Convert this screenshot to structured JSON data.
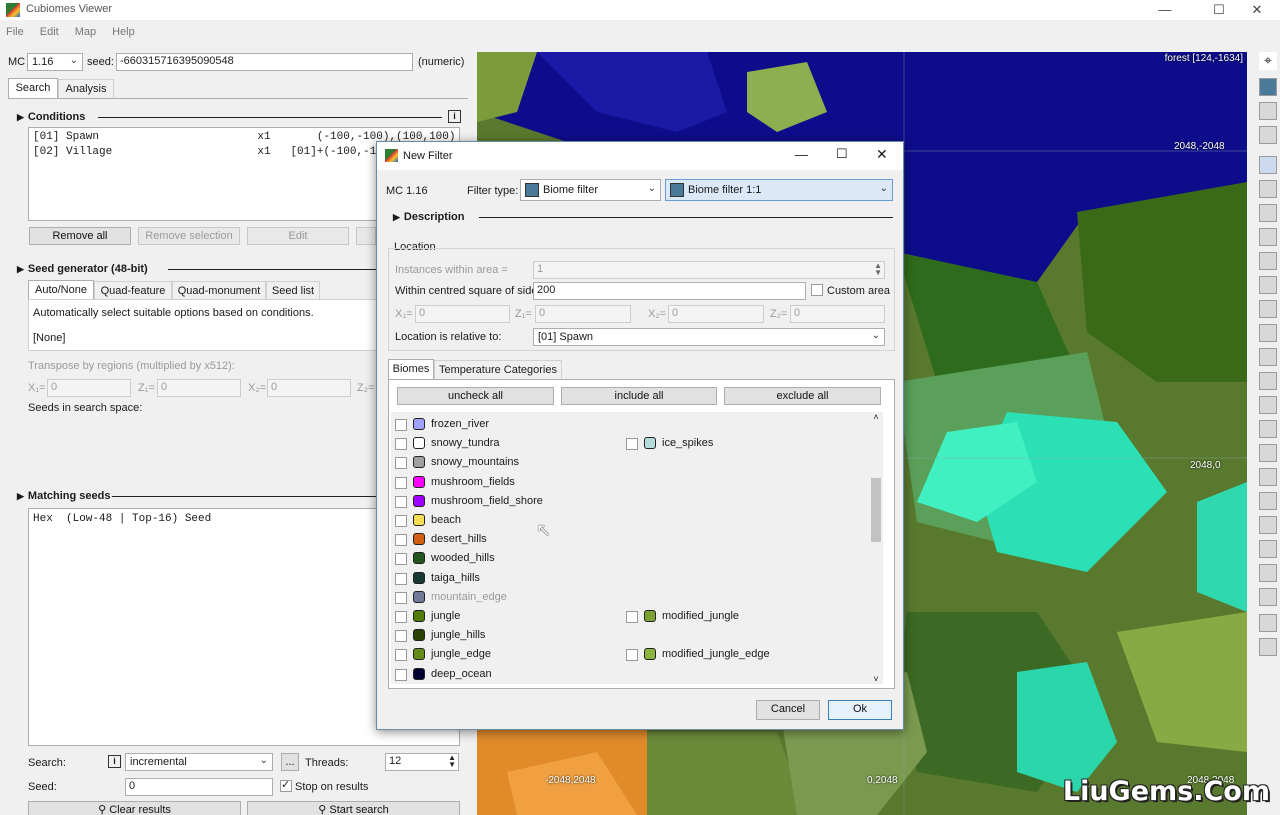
{
  "window": {
    "title": "Cubiomes Viewer"
  },
  "menu": [
    "File",
    "Edit",
    "Map",
    "Help"
  ],
  "top": {
    "mc_label": "MC",
    "mc_version": "1.16",
    "seed_label": "seed:",
    "seed_value": "-660315716395090548",
    "seed_type": "(numeric)"
  },
  "main_tabs": [
    "Search",
    "Analysis"
  ],
  "conditions": {
    "title": "Conditions",
    "rows": [
      "[01] Spawn                        x1       (-100,-100),(100,100)",
      "[02] Village                      x1   [01]+(-100,-100),(1"
    ],
    "buttons": {
      "remove_all": "Remove all",
      "remove_selection": "Remove selection",
      "edit": "Edit"
    }
  },
  "seed_generator": {
    "title": "Seed generator (48-bit)",
    "tabs": [
      "Auto/None",
      "Quad-feature",
      "Quad-monument",
      "Seed list"
    ],
    "desc": "Automatically select suitable options based on conditions.",
    "mode": "[None]",
    "transpose": "Transpose by regions (multiplied by x512):",
    "x1": "X₁=",
    "z1": "Z₁=",
    "x2": "X₂=",
    "z2": "Z₂=",
    "zero": "0",
    "seeds_space": "Seeds in search space:"
  },
  "matching": {
    "title": "Matching seeds",
    "header": "Hex  (Low-48 | Top-16) Seed"
  },
  "bottom": {
    "search_label": "Search:",
    "search_mode": "incremental",
    "more": "...",
    "threads_label": "Threads:",
    "threads_value": "12",
    "seed_label": "Seed:",
    "seed_value": "0",
    "stop_label": "Stop on results",
    "clear": "Clear results",
    "start": "Start search"
  },
  "map": {
    "biome_readout": "forest [124,-1634]",
    "coords": [
      "2048,-2048",
      "2048,0",
      "-2048,2048",
      "0,2048",
      "2048,2048"
    ]
  },
  "dialog": {
    "title": "New Filter",
    "mc": "MC 1.16",
    "filter_type_label": "Filter type:",
    "filter_type": "Biome filter",
    "filter_sub": "Biome filter 1:1",
    "description": "Description",
    "location": "Location",
    "instances_label": "Instances within area =",
    "instances_value": "1",
    "square_label": "Within centred square of side =",
    "square_value": "200",
    "custom_area": "Custom area",
    "x1": "X₁=",
    "z1": "Z₁=",
    "x2": "X₂=",
    "z2": "Z₂=",
    "zero": "0",
    "relative_label": "Location is relative to:",
    "relative_value": "[01] Spawn",
    "tabs": [
      "Biomes",
      "Temperature Categories"
    ],
    "uncheck_all": "uncheck all",
    "include_all": "include all",
    "exclude_all": "exclude all",
    "biomes_left": [
      {
        "name": "frozen_river",
        "color": "#a0a0ff"
      },
      {
        "name": "snowy_tundra",
        "color": "#ffffff"
      },
      {
        "name": "snowy_mountains",
        "color": "#a0a0a0"
      },
      {
        "name": "mushroom_fields",
        "color": "#ff00ff"
      },
      {
        "name": "mushroom_field_shore",
        "color": "#a000ff"
      },
      {
        "name": "beach",
        "color": "#fade55"
      },
      {
        "name": "desert_hills",
        "color": "#d25f12"
      },
      {
        "name": "wooded_hills",
        "color": "#22551c"
      },
      {
        "name": "taiga_hills",
        "color": "#163933"
      },
      {
        "name": "mountain_edge",
        "color": "#72789a",
        "disabled": true
      },
      {
        "name": "jungle",
        "color": "#537b09"
      },
      {
        "name": "jungle_hills",
        "color": "#2c4205"
      },
      {
        "name": "jungle_edge",
        "color": "#628b17"
      },
      {
        "name": "deep_ocean",
        "color": "#000030"
      }
    ],
    "biomes_right": [
      {
        "row": 1,
        "name": "ice_spikes",
        "color": "#b4dcdc"
      },
      {
        "row": 10,
        "name": "modified_jungle",
        "color": "#7ba331"
      },
      {
        "row": 12,
        "name": "modified_jungle_edge",
        "color": "#8ab33f"
      }
    ],
    "cancel": "Cancel",
    "ok": "Ok"
  },
  "watermark": "LiuGems.Com"
}
